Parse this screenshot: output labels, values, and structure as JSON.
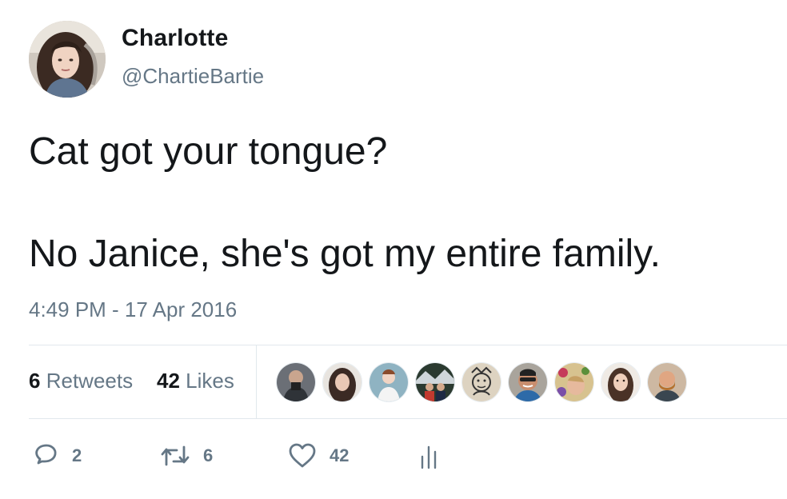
{
  "author": {
    "name": "Charlotte",
    "handle": "@ChartieBartie",
    "avatar_icon": "profile-photo"
  },
  "tweet": {
    "lines": [
      "Cat got your tongue?",
      "",
      "No Janice, she's got my entire family."
    ]
  },
  "timestamp": "4:49 PM - 17 Apr 2016",
  "stats": {
    "retweets_count": "6",
    "retweets_label": "Retweets",
    "likes_count": "42",
    "likes_label": "Likes"
  },
  "facepile": {
    "avatars": [
      "liker-avatar-1",
      "liker-avatar-2",
      "liker-avatar-3",
      "liker-avatar-4",
      "liker-avatar-5",
      "liker-avatar-6",
      "liker-avatar-7",
      "liker-avatar-8",
      "liker-avatar-9"
    ]
  },
  "actions": {
    "replies_count": "2",
    "retweets_count": "6",
    "likes_count": "42",
    "icons": [
      "reply-icon",
      "retweet-icon",
      "heart-icon",
      "analytics-icon"
    ]
  },
  "colors": {
    "text_primary": "#14171a",
    "text_secondary": "#657786",
    "divider": "#e1e8ed"
  }
}
